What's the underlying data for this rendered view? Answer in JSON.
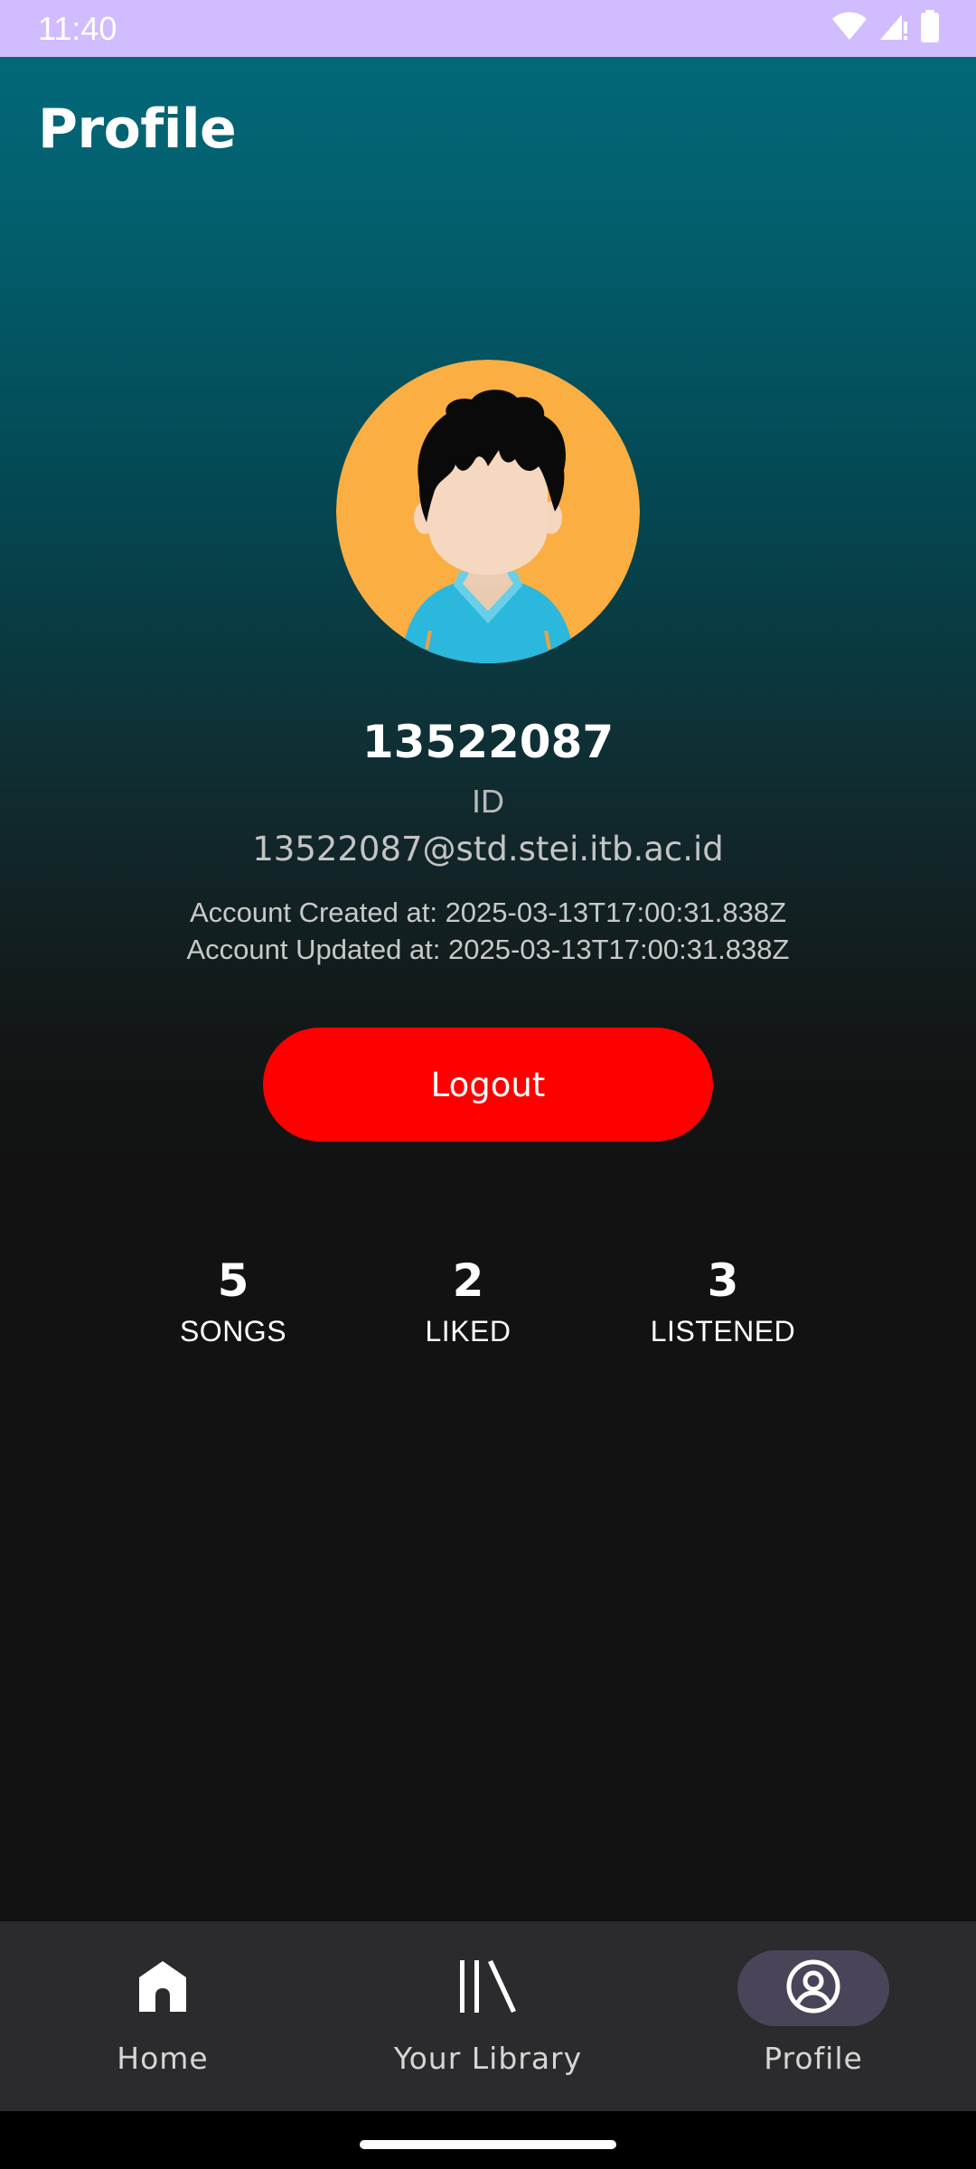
{
  "status_bar": {
    "time": "11:40",
    "icons": [
      "wifi-icon",
      "signal-icon",
      "battery-icon"
    ]
  },
  "header": {
    "title": "Profile"
  },
  "profile": {
    "avatar": "avatar-illustration",
    "username": "13522087",
    "id_label": "ID",
    "email": "13522087@std.stei.itb.ac.id",
    "created": "Account Created at: 2025-03-13T17:00:31.838Z",
    "updated": "Account Updated at: 2025-03-13T17:00:31.838Z"
  },
  "logout": {
    "label": "Logout",
    "color": "#ff0000"
  },
  "stats": {
    "songs": {
      "value": "5",
      "label": "SONGS"
    },
    "liked": {
      "value": "2",
      "label": "LIKED"
    },
    "listened": {
      "value": "3",
      "label": "LISTENED"
    }
  },
  "bottom_nav": {
    "items": [
      {
        "label": "Home",
        "icon": "home-icon",
        "active": false
      },
      {
        "label": "Your Library",
        "icon": "library-icon",
        "active": false
      },
      {
        "label": "Profile",
        "icon": "profile-icon",
        "active": true
      }
    ],
    "active_indicator_color": "#4a4458"
  },
  "colors": {
    "status_bar": "#d0bcff",
    "gradient_top": "#026b7c",
    "background": "#121212",
    "nav_background": "#2b2a2c"
  }
}
